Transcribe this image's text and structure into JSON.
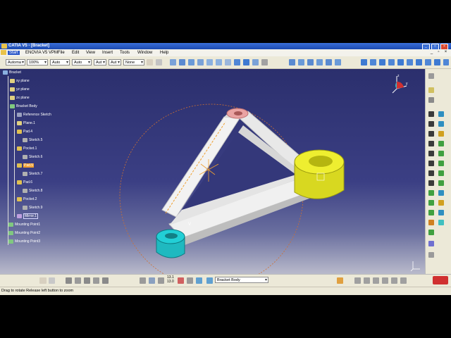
{
  "window": {
    "title": "CATIA V5 - [Bracket]"
  },
  "menu": {
    "items": [
      "Start",
      "ENOVIA V5 VPM",
      "File",
      "Edit",
      "View",
      "Insert",
      "Tools",
      "Window",
      "Help"
    ]
  },
  "toolbar": {
    "combos": [
      "Automa",
      "100%",
      "Auto",
      "Auto",
      "Aut",
      "Aut",
      "None"
    ]
  },
  "tree": {
    "root": "Bracket",
    "planes": [
      "xy plane",
      "yz plane",
      "zx plane"
    ],
    "body": "Bracket Body",
    "features": [
      {
        "label": "Reference Sketch",
        "level": 1
      },
      {
        "label": "Plane.1",
        "level": 1
      },
      {
        "label": "Pad.4",
        "level": 1
      },
      {
        "label": "Sketch.5",
        "level": 2
      },
      {
        "label": "Pocket.1",
        "level": 1
      },
      {
        "label": "Sketch.6",
        "level": 2
      },
      {
        "label": "Pad.5",
        "level": 1
      },
      {
        "label": "Sketch.7",
        "level": 2
      },
      {
        "label": "Pad.6",
        "level": 1
      },
      {
        "label": "Sketch.8",
        "level": 2
      },
      {
        "label": "Pocket.2",
        "level": 1
      },
      {
        "label": "Sketch.9",
        "level": 2
      },
      {
        "label": "Mirror.1",
        "level": 1
      }
    ],
    "mounting": [
      "Mounting Point1",
      "Mounting Point2",
      "Mounting Point3"
    ]
  },
  "bottom": {
    "body_combo": "Bracket Body",
    "zoom_top": "13.1",
    "zoom_bottom": "13.0"
  },
  "status": {
    "message": "Drag to rotate  Release left button to zoom"
  },
  "colors": {
    "viewport_top": "#2b2f6d",
    "part_white": "#f2f2f2",
    "boss_yellow": "#e8e822",
    "boss_cyan": "#22cfd6",
    "boss_pink": "#e9a3a3",
    "selection": "#f0a030"
  }
}
